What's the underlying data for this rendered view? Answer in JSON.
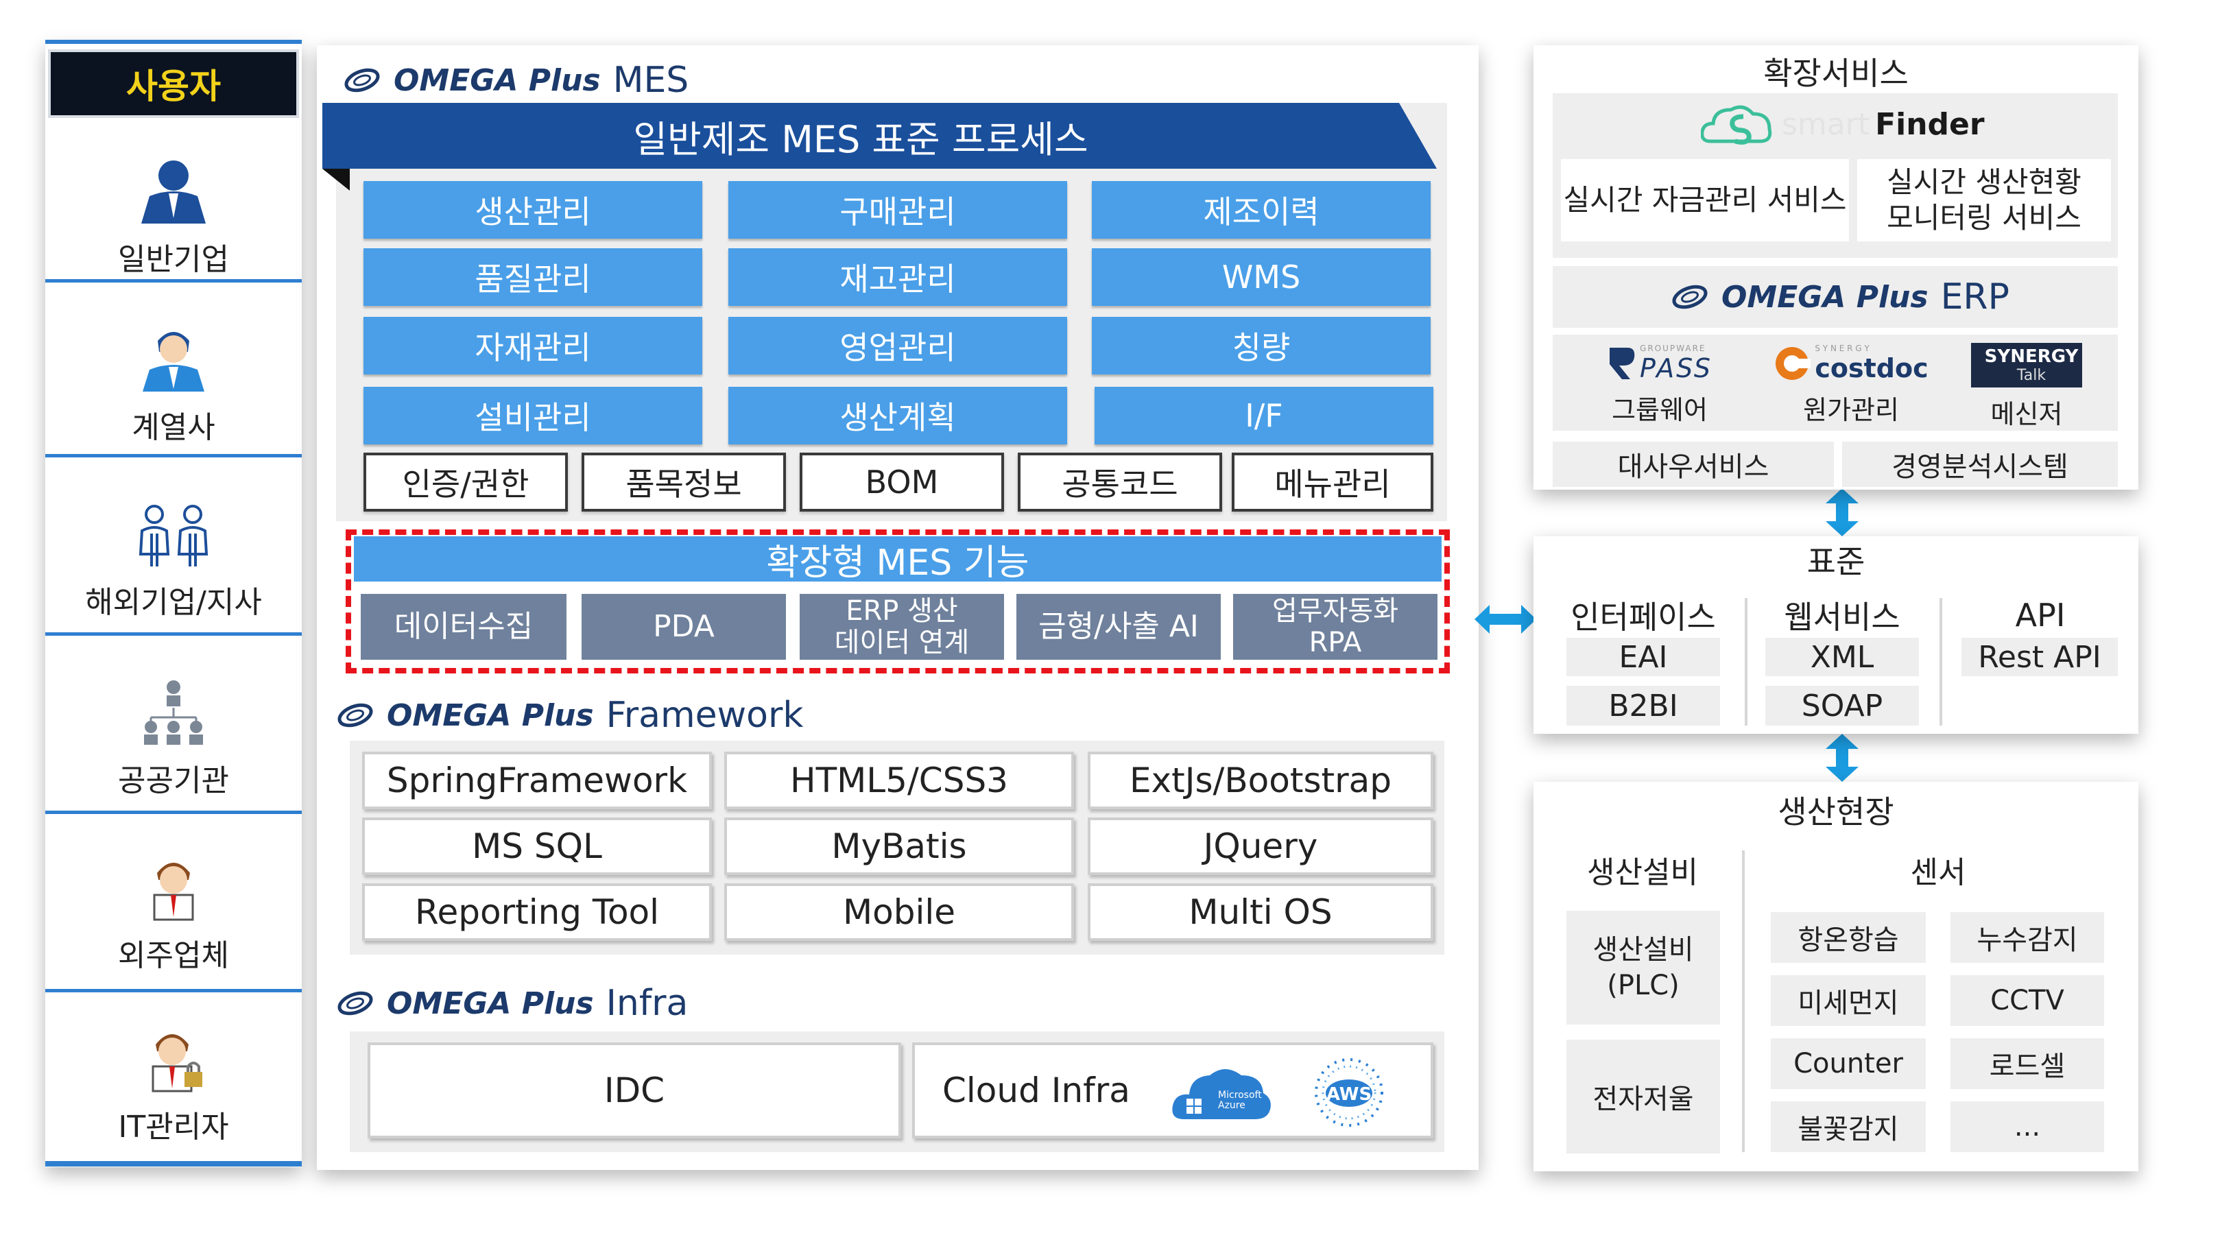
{
  "users": {
    "title": "사용자",
    "items": [
      {
        "label": "일반기업",
        "icon": "business-person-icon"
      },
      {
        "label": "계열사",
        "icon": "affiliate-person-icon"
      },
      {
        "label": "해외기업/지사",
        "icon": "overseas-group-icon"
      },
      {
        "label": "공공기관",
        "icon": "org-hierarchy-icon"
      },
      {
        "label": "외주업체",
        "icon": "contractor-person-icon"
      },
      {
        "label": "IT관리자",
        "icon": "it-admin-person-icon"
      }
    ]
  },
  "mes": {
    "brand_logo": "OMEGA Plus",
    "brand_word": "MES",
    "process_title": "일반제조 MES 표준 프로세스",
    "modules": [
      [
        "생산관리",
        "구매관리",
        "제조이력"
      ],
      [
        "품질관리",
        "재고관리",
        "WMS"
      ],
      [
        "자재관리",
        "영업관리",
        "칭량"
      ],
      [
        "설비관리",
        "생산계획",
        "I/F"
      ]
    ],
    "base_modules": [
      "인증/권한",
      "품목정보",
      "BOM",
      "공통코드",
      "메뉴관리"
    ],
    "extended_title": "확장형 MES 기능",
    "extended_items": [
      "데이터수집",
      "PDA",
      "ERP 생산\n데이터 연계",
      "금형/사출 AI",
      "업무자동화\nRPA"
    ]
  },
  "framework": {
    "brand_logo": "OMEGA Plus",
    "brand_word": "Framework",
    "items": [
      [
        "SpringFramework",
        "HTML5/CSS3",
        "ExtJs/Bootstrap"
      ],
      [
        "MS SQL",
        "MyBatis",
        "JQuery"
      ],
      [
        "Reporting Tool",
        "Mobile",
        "Multi OS"
      ]
    ]
  },
  "infra": {
    "brand_logo": "OMEGA Plus",
    "brand_word": "Infra",
    "idc": "IDC",
    "cloud": "Cloud Infra",
    "azure_logo": "Microsoft\nAzure",
    "aws_logo": "AWS"
  },
  "extension": {
    "title": "확장서비스",
    "smartfinder_light": "smart",
    "smartfinder_bold": "Finder",
    "service_1": "실시간 자금관리 서비스",
    "service_2": "실시간 생산현황\n모니터링 서비스",
    "erp_logo": "OMEGA Plus",
    "erp_word": "ERP",
    "pass_sub": "GROUPWARE",
    "pass_logo": "PASS",
    "pass_label": "그룹웨어",
    "costdoc_sub": "S Y N E R G Y",
    "costdoc_logo": "costdoc",
    "costdoc_label": "원가관리",
    "synergy_logo_1": "SYNERGY",
    "synergy_logo_2": "Talk",
    "synergy_label": "메신저",
    "office_service": "대사우서비스",
    "analysis_system": "경영분석시스템"
  },
  "standard": {
    "title": "표준",
    "col1": [
      "인터페이스",
      "EAI",
      "B2BI"
    ],
    "col2": [
      "웹서비스",
      "XML",
      "SOAP"
    ],
    "col3": [
      "API",
      "Rest API"
    ]
  },
  "field": {
    "title": "생산현장",
    "equipment_header": "생산설비",
    "sensor_header": "센서",
    "equipment_items": [
      "생산설비\n(PLC)",
      "전자저울"
    ],
    "sensor_items": [
      [
        "항온항습",
        "누수감지"
      ],
      [
        "미세먼지",
        "CCTV"
      ],
      [
        "Counter",
        "로드셀"
      ],
      [
        "불꽃감지",
        "..."
      ]
    ]
  },
  "colors": {
    "module_blue": "#4a9fe8",
    "banner_navy": "#1a4f9c",
    "extended_grey": "#6f819c",
    "dashed_red": "#e8141c",
    "arrow_blue": "#1a9be0",
    "brand_navy": "#1c3a6b",
    "user_title_yellow": "#f2d21a"
  }
}
